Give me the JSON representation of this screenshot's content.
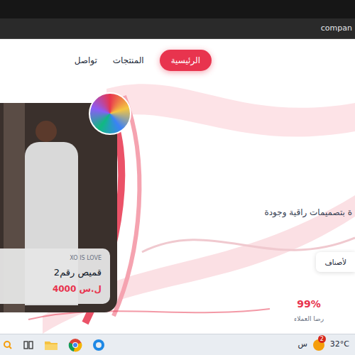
{
  "browser": {
    "address": "compan"
  },
  "nav": [
    {
      "label": "الرئيسية",
      "selected": true
    },
    {
      "label": "المنتجات",
      "selected": false
    },
    {
      "label": "تواصل",
      "selected": false
    }
  ],
  "product": {
    "brand": "XO IS LOVE",
    "name": "قميص رقم2",
    "price": "4000 ل.س"
  },
  "hero": {
    "tagline": "ة بتصميمات راقية وجودة",
    "button": "لأصناف"
  },
  "stats": [
    {
      "value": "99%",
      "label": "رضا العملاء"
    }
  ],
  "taskbar": {
    "label": "س",
    "weather": "32°C",
    "badge": "2"
  }
}
